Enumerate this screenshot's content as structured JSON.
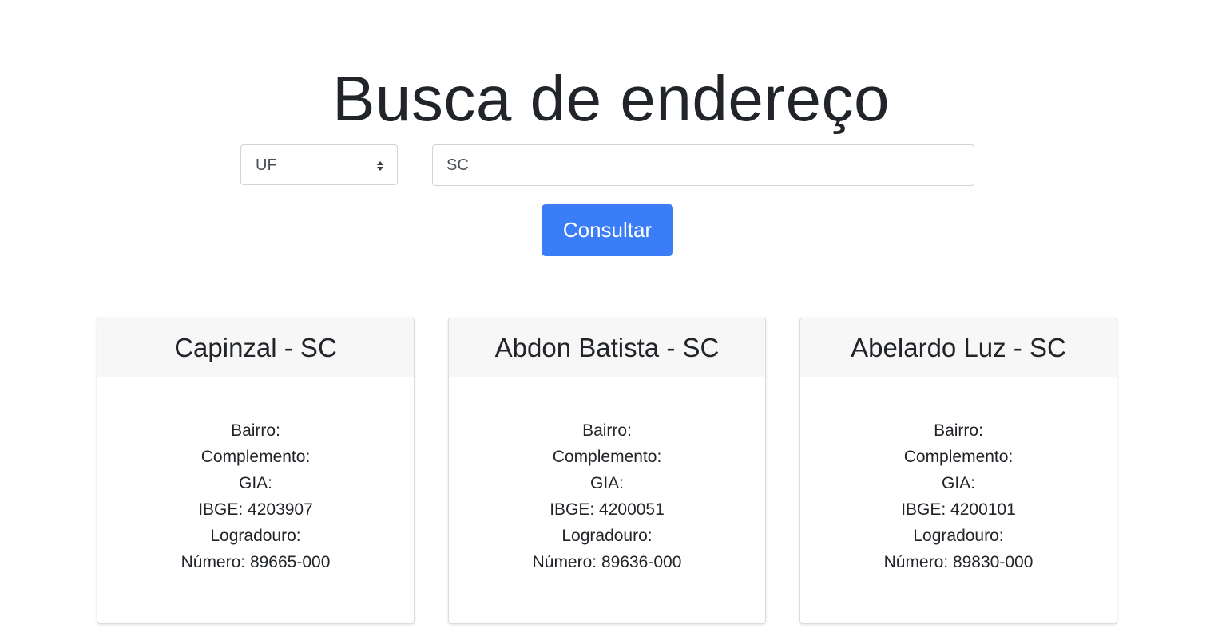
{
  "page": {
    "title": "Busca de endereço"
  },
  "form": {
    "select_value": "UF",
    "input_value": "SC",
    "button_label": "Consultar"
  },
  "colors": {
    "primary_button": "#3b7df6",
    "card_header_bg": "#f7f7f7"
  },
  "cards": [
    {
      "title": "Capinzal - SC",
      "lines": [
        "Bairro:",
        "Complemento:",
        "GIA:",
        "IBGE: 4203907",
        "Logradouro:",
        "Número: 89665-000"
      ]
    },
    {
      "title": "Abdon Batista - SC",
      "lines": [
        "Bairro:",
        "Complemento:",
        "GIA:",
        "IBGE: 4200051",
        "Logradouro:",
        "Número: 89636-000"
      ]
    },
    {
      "title": "Abelardo Luz - SC",
      "lines": [
        "Bairro:",
        "Complemento:",
        "GIA:",
        "IBGE: 4200101",
        "Logradouro:",
        "Número: 89830-000"
      ]
    }
  ]
}
